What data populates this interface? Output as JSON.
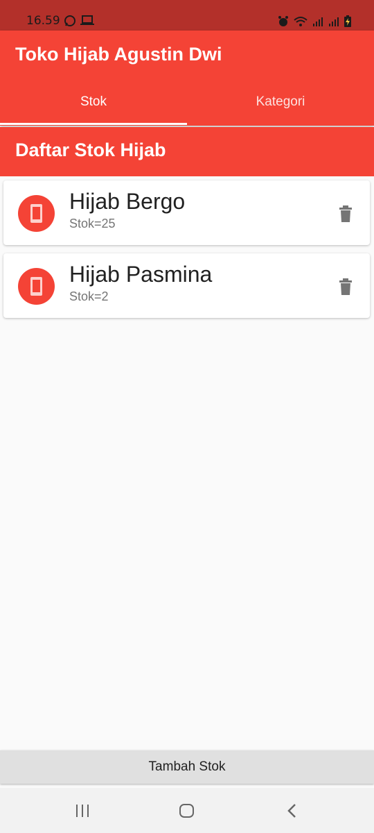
{
  "status_bar": {
    "time": "16.59",
    "icons": [
      "whatsapp-icon",
      "laptop-icon",
      "alarm-icon",
      "wifi-icon",
      "signal-icon",
      "signal-icon",
      "battery-charging-icon"
    ]
  },
  "app_bar": {
    "title": "Toko Hijab Agustin Dwi",
    "tabs": [
      {
        "label": "Stok",
        "active": true
      },
      {
        "label": "Kategori",
        "active": false
      }
    ]
  },
  "section": {
    "title": "Daftar Stok Hijab"
  },
  "items": [
    {
      "name": "Hijab Bergo",
      "stock": "Stok=25",
      "icon": "phone-icon",
      "action_icon": "trash-icon"
    },
    {
      "name": "Hijab Pasmina",
      "stock": "Stok=2",
      "icon": "phone-icon",
      "action_icon": "trash-icon"
    }
  ],
  "bottom_button": {
    "label": "Tambah Stok"
  },
  "nav_bar": {
    "buttons": [
      "recent-apps-icon",
      "home-icon",
      "back-icon"
    ]
  },
  "colors": {
    "primary": "#f44336",
    "status_bar": "#b3302a",
    "background": "#fafafa",
    "button": "#e0e0e0"
  }
}
